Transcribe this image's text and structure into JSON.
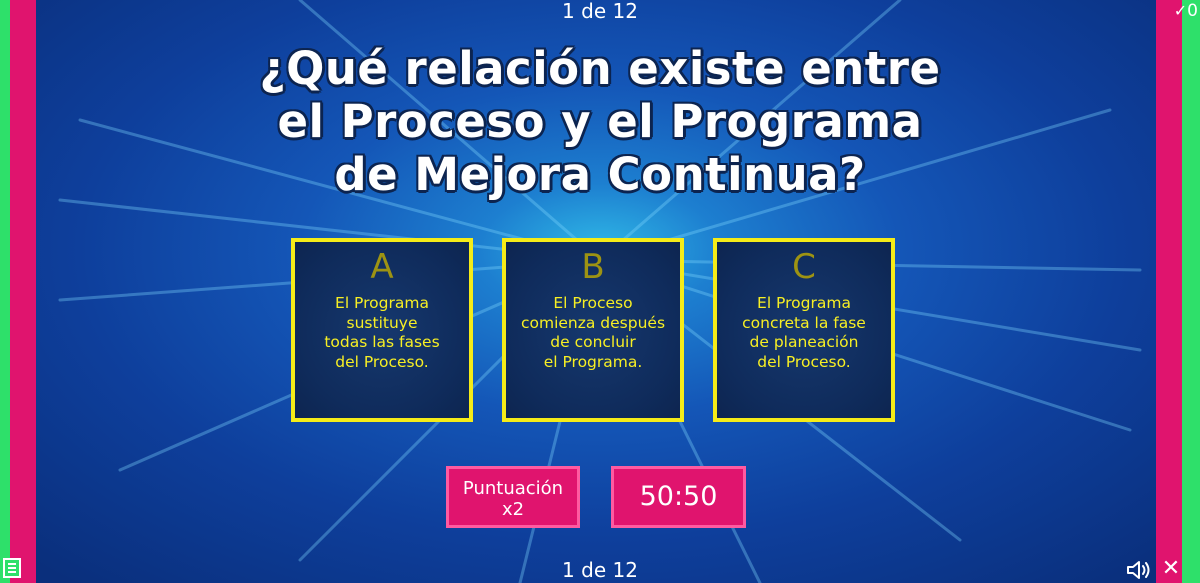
{
  "progress": {
    "top_label": "1 de 12",
    "bottom_label": "1 de 12"
  },
  "question": {
    "line1": "¿Qué relación existe entre",
    "line2": "el Proceso y el Programa",
    "line3": "de Mejora Continua?"
  },
  "options": [
    {
      "letter": "A",
      "lines": [
        "El Programa",
        "sustituye",
        "todas las fases",
        "del Proceso."
      ]
    },
    {
      "letter": "B",
      "lines": [
        "El Proceso",
        "comienza después",
        "de concluir",
        "el Programa."
      ]
    },
    {
      "letter": "C",
      "lines": [
        "El Programa",
        "concreta la fase",
        "de planeación",
        "del Proceso."
      ]
    }
  ],
  "bonus": {
    "line1": "Puntuación",
    "line2": "x2"
  },
  "timer": {
    "value": "50:50"
  },
  "score_indicator": {
    "icon": "check-icon",
    "value": "0"
  },
  "icons": {
    "menu": "menu-icon",
    "sound": "speaker-icon",
    "close": "close-icon"
  },
  "colors": {
    "accent_pink": "#e0146e",
    "accent_green": "#2ee06a",
    "option_border": "#f5ec18",
    "option_text": "#f7ef24",
    "letter": "#9d9313"
  }
}
